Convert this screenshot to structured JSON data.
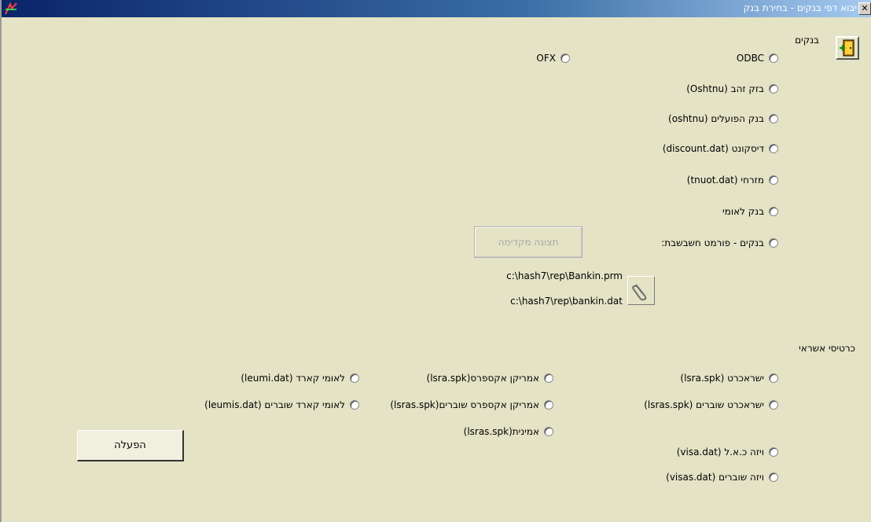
{
  "window": {
    "title": "יבוא דפי בנקים - בחירת בנק",
    "close_label": "✕"
  },
  "banks": {
    "heading": "בנקים",
    "options": [
      {
        "label": "ODBC"
      },
      {
        "label": "OFX"
      },
      {
        "label": "בזק זהב (Oshtnu)"
      },
      {
        "label": "בנק הפועלים (oshtnu)"
      },
      {
        "label": "דיסקונט (discount.dat)"
      },
      {
        "label": "מזרחי  (tnuot.dat)"
      },
      {
        "label": "בנק לאומי"
      },
      {
        "label": "בנקים - פורמט חשבשבת:"
      }
    ],
    "preview_label": "תצוגה מקדימה",
    "path_prm": "c:\\hash7\\rep\\Bankin.prm",
    "path_dat": "c:\\hash7\\rep\\bankin.dat"
  },
  "cards": {
    "heading": "כרטיסי אשראי",
    "options": [
      {
        "label": "ישראכרט (lsra.spk)"
      },
      {
        "label": "אמריקן אקספרס(lsra.spk)"
      },
      {
        "label": "לאומי קארד (leumi.dat)"
      },
      {
        "label": "ישראכרט שוברים (lsras.spk)"
      },
      {
        "label": "אמריקן אקספרס שוברים(lsras.spk)"
      },
      {
        "label": "לאומי קארד שוברים (leumis.dat)"
      },
      {
        "label": "אמינית(lsras.spk)"
      },
      {
        "label": "ויזה כ.א.ל (visa.dat)"
      },
      {
        "label": "ויזה שוברים (visas.dat)"
      }
    ]
  },
  "run_label": "הפעלה",
  "colors": {
    "background": "#e4e3c6",
    "titlebar": "#0a246a"
  },
  "icons": [
    "close-icon",
    "app-icon",
    "exit-door-icon",
    "paperclip-icon"
  ]
}
